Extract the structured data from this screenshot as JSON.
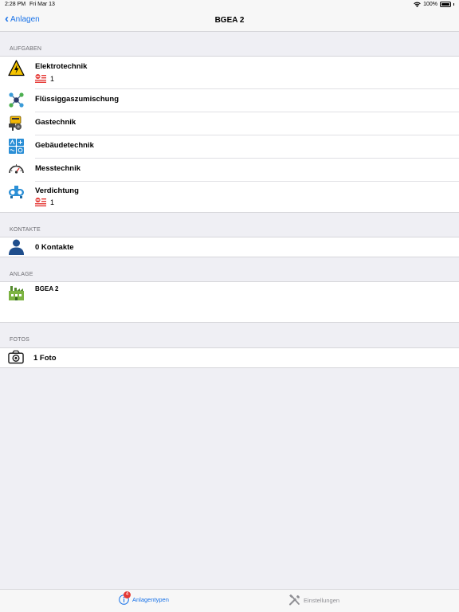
{
  "status_bar": {
    "time": "2:28 PM",
    "date": "Fri Mar 13",
    "battery": "100%"
  },
  "nav": {
    "back_label": "Anlagen",
    "title": "BGEA 2"
  },
  "sections": {
    "aufgaben": {
      "header": "AUFGABEN",
      "items": [
        {
          "label": "Elektrotechnik",
          "icon": "high-voltage-warning-icon",
          "count": "1"
        },
        {
          "label": "Flüssiggaszumischung",
          "icon": "molecule-icon"
        },
        {
          "label": "Gastechnik",
          "icon": "gas-burner-icon"
        },
        {
          "label": "Gebäudetechnik",
          "icon": "building-services-icon"
        },
        {
          "label": "Messtechnik",
          "icon": "gauge-icon"
        },
        {
          "label": "Verdichtung",
          "icon": "compressor-icon",
          "count": "1"
        }
      ]
    },
    "kontakte": {
      "header": "KONTAKTE",
      "label": "0 Kontakte",
      "icon": "person-icon"
    },
    "anlage": {
      "header": "ANLAGE",
      "label": "BGEA 2",
      "icon": "factory-icon"
    },
    "fotos": {
      "header": "FOTOS",
      "label": "1 Foto",
      "icon": "camera-icon"
    }
  },
  "tab_bar": {
    "tabs": [
      {
        "label": "Anlagentypen",
        "icon": "info-icon",
        "badge": "4",
        "active": true
      },
      {
        "label": "Einstellungen",
        "icon": "tools-icon",
        "active": false
      }
    ]
  },
  "colors": {
    "accent": "#1a73e8",
    "badge": "#e53935",
    "background": "#efeff4"
  }
}
